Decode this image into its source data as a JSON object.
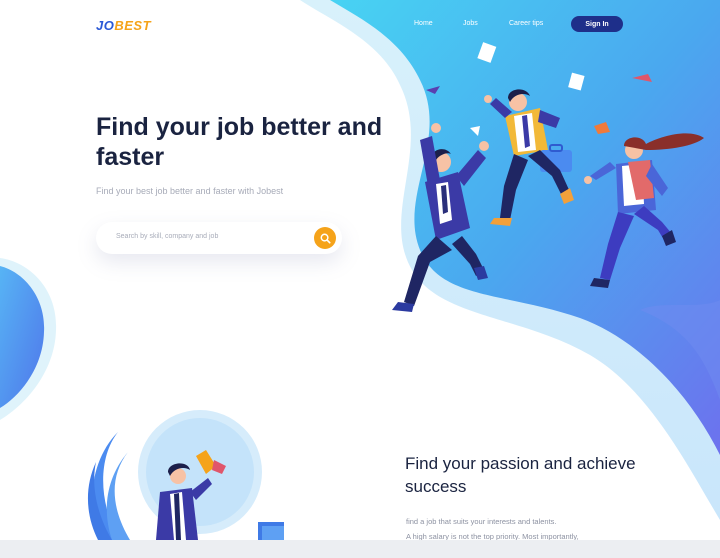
{
  "header": {
    "logo_part1": "JO",
    "logo_part2": "BEST",
    "nav": [
      "Home",
      "Jobs",
      "Career tips"
    ],
    "signin_label": "Sign In"
  },
  "hero": {
    "title": "Find your job better and faster",
    "subtitle": "Find your best job better and faster with Jobest",
    "search_placeholder": "Search by skill, company and job",
    "search_icon": "search-icon"
  },
  "section2": {
    "title": "Find your passion and achieve success",
    "text_line1": "find a job that suits your interests and talents.",
    "text_line2": "A high salary is not the top priority. Most importantly,"
  },
  "colors": {
    "brand_blue": "#2b59d6",
    "brand_orange": "#f5a31a",
    "title_dark": "#1a2340",
    "signin_bg": "#1e2f8a"
  }
}
